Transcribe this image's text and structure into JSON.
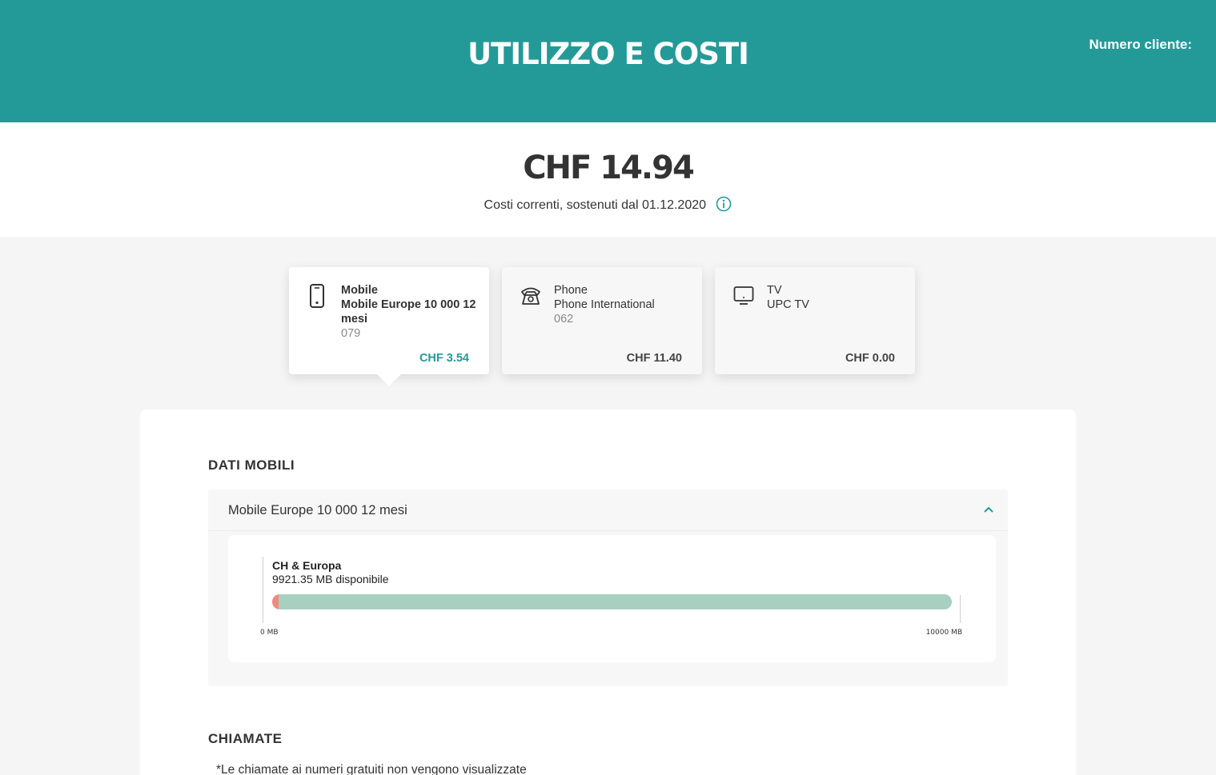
{
  "header": {
    "title": "UTILIZZO E COSTI",
    "customer_number_label": "Numero cliente:"
  },
  "summary": {
    "total": "CHF 14.94",
    "since_text": "Costi correnti, sostenuti dal 01.12.2020"
  },
  "cards": [
    {
      "type": "Mobile",
      "plan": "Mobile Europe 10 000 12 mesi",
      "number": "079",
      "price": "CHF 3.54",
      "icon": "mobile-phone-icon",
      "active": true
    },
    {
      "type": "Phone",
      "plan": "Phone International",
      "number": "062",
      "price": "CHF 11.40",
      "icon": "landline-phone-icon",
      "active": false
    },
    {
      "type": "TV",
      "plan": "UPC TV",
      "number": "",
      "price": "CHF 0.00",
      "icon": "tv-icon",
      "active": false
    }
  ],
  "mobile_data": {
    "section_title": "DATI MOBILI",
    "plan_title": "Mobile Europe 10 000 12 mesi",
    "region_label": "CH & Europa",
    "available_text": "9921.35 MB disponibile",
    "used_fraction": 0.0079,
    "scale_min": "0 MB",
    "scale_max": "10000 MB"
  },
  "calls": {
    "section_title": "CHIAMATE",
    "note": "*Le chiamate ai numeri gratuiti non vengono visualizzate"
  },
  "colors": {
    "brand": "#249a98",
    "bar_available": "#a8d0c0",
    "bar_used": "#f08a7e"
  }
}
